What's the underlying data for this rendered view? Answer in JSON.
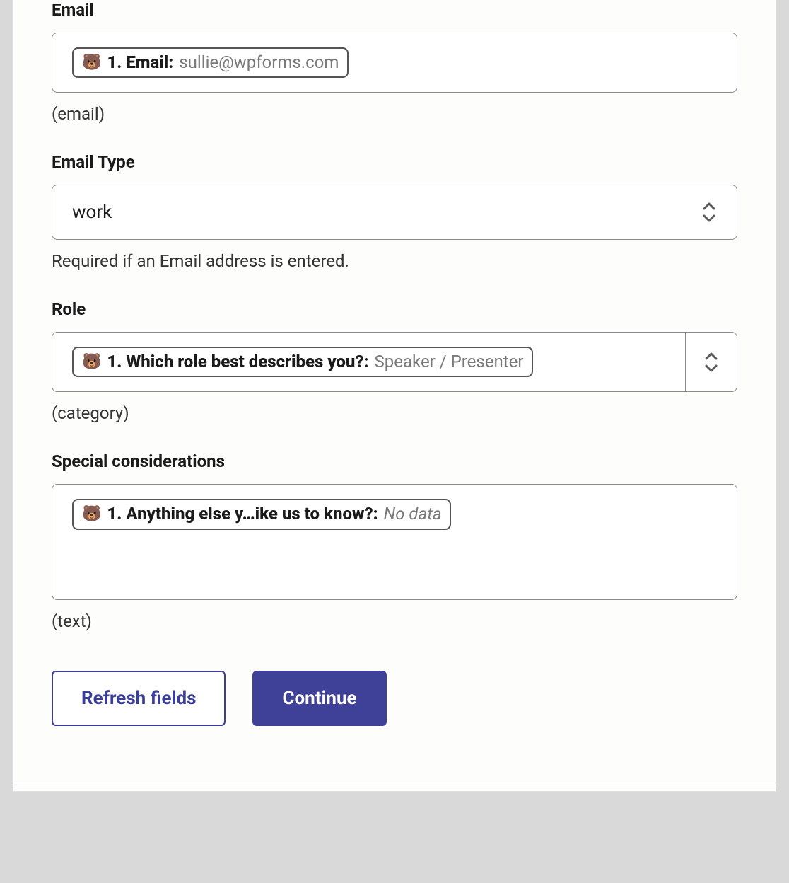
{
  "fields": {
    "email": {
      "label": "Email",
      "tag_label": "1. Email:",
      "tag_value": "sullie@wpforms.com",
      "helper": "(email)"
    },
    "email_type": {
      "label": "Email Type",
      "value": "work",
      "helper": "Required if an Email address is entered."
    },
    "role": {
      "label": "Role",
      "tag_label": "1. Which role best describes you?:",
      "tag_value": "Speaker / Presenter",
      "helper": "(category)"
    },
    "special": {
      "label": "Special considerations",
      "tag_label": "1. Anything else y…ike us to know?:",
      "tag_value": "No data",
      "helper": "(text)"
    }
  },
  "buttons": {
    "refresh": "Refresh fields",
    "continue": "Continue"
  },
  "icons": {
    "wpforms_emoji": "🐻"
  }
}
